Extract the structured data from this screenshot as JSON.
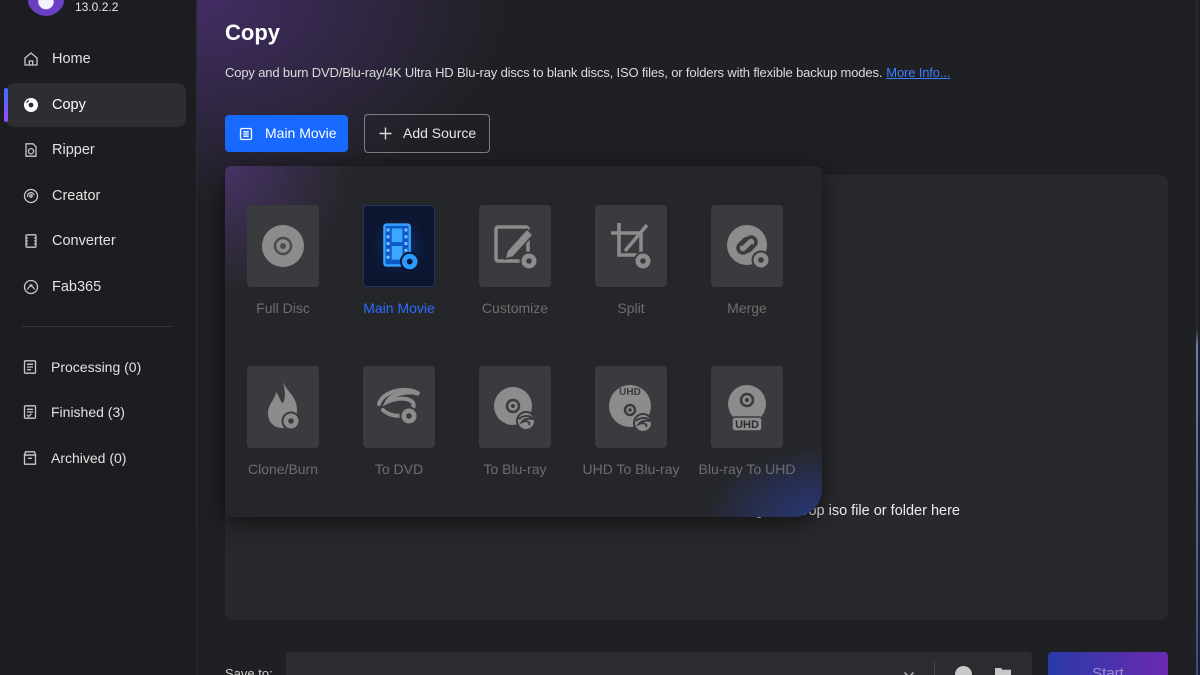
{
  "app": {
    "version": "13.0.2.2",
    "logo": "dvdfab-logo"
  },
  "sidebar": {
    "nav": [
      {
        "label": "Home",
        "icon": "home-icon",
        "selected": false
      },
      {
        "label": "Copy",
        "icon": "copy-disc-icon",
        "selected": true
      },
      {
        "label": "Ripper",
        "icon": "ripper-icon",
        "selected": false
      },
      {
        "label": "Creator",
        "icon": "creator-icon",
        "selected": false
      },
      {
        "label": "Converter",
        "icon": "converter-icon",
        "selected": false
      },
      {
        "label": "Fab365",
        "icon": "fab365-icon",
        "selected": false
      }
    ],
    "queues": [
      {
        "label": "Processing (0)",
        "icon": "processing-icon"
      },
      {
        "label": "Finished (3)",
        "icon": "finished-icon"
      },
      {
        "label": "Archived (0)",
        "icon": "archive-icon"
      }
    ]
  },
  "main": {
    "title": "Copy",
    "description": "Copy and burn DVD/Blu-ray/4K Ultra HD Blu-ray discs to blank discs, ISO files, or folders with flexible backup modes.",
    "more_info": "More Info...",
    "mode_button": {
      "label": "Main Movie",
      "icon": "main-movie-icon"
    },
    "add_source_button": {
      "label": "Add Source",
      "icon": "plus-icon"
    },
    "drop_hint": "Drag and drop iso file or folder here"
  },
  "mode_menu": {
    "badge_text": "UHD",
    "items": [
      {
        "label": "Full Disc",
        "icon": "full-disc-icon",
        "selected": false
      },
      {
        "label": "Main Movie",
        "icon": "main-movie-film-icon",
        "selected": true
      },
      {
        "label": "Customize",
        "icon": "customize-icon",
        "selected": false
      },
      {
        "label": "Split",
        "icon": "split-icon",
        "selected": false
      },
      {
        "label": "Merge",
        "icon": "merge-icon",
        "selected": false
      },
      {
        "label": "Clone/Burn",
        "icon": "clone-burn-icon",
        "selected": false
      },
      {
        "label": "To DVD",
        "icon": "to-dvd-icon",
        "selected": false
      },
      {
        "label": "To Blu-ray",
        "icon": "to-bluray-icon",
        "selected": false
      },
      {
        "label": "UHD To Blu-ray",
        "icon": "uhd-to-bluray-icon",
        "selected": false
      },
      {
        "label": "Blu-ray To UHD",
        "icon": "bluray-to-uhd-icon",
        "selected": false
      }
    ]
  },
  "output": {
    "save_to_label": "Save to:",
    "start_button": "Start",
    "icons": [
      "chevron-down-icon",
      "iso-disc-icon",
      "folder-icon"
    ]
  },
  "colors": {
    "background": "#1f2023",
    "sidebar": "#1c1d20",
    "panel": "#28292c",
    "accent_blue": "#1769ff",
    "link": "#3d7eff",
    "selected_mode_label": "#2b6cff",
    "disabled_label": "#6e6e6e",
    "start_gradient": [
      "#2a3aa8",
      "#6a2ab0"
    ]
  }
}
